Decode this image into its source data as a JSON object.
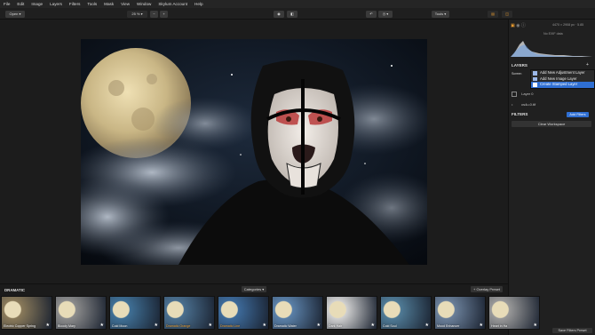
{
  "menubar": {
    "items": [
      "File",
      "Edit",
      "Image",
      "Layers",
      "Filters",
      "Tools",
      "Mask",
      "View",
      "Window",
      "Skylum Account",
      "Help"
    ]
  },
  "toolbar": {
    "open_label": "Open",
    "zoom_value": "25 %",
    "zoom_minus": "−",
    "zoom_plus": "+",
    "tools_label": "Tools"
  },
  "right_panel": {
    "image_info": "4470 × 2908 px · 5.85",
    "no_exif": "No EXIF data",
    "layers_title": "LAYERS",
    "blend_mode": "Screen",
    "layer_names": [
      "Layer 0",
      "cs4u.0.tif"
    ],
    "context_menu": [
      "Add New Adjustment Layer",
      "Add New Image Layer",
      "Create Stamped Layer"
    ],
    "filters_title": "FILTERS",
    "add_filters_label": "Add Filters",
    "clear_workspace_label": "Clear Workspace",
    "save_preset_label": "Save Filters Preset"
  },
  "presets": {
    "category_title": "DRAMATIC",
    "categories_label": "Categories",
    "overlay_label": "+ Overlay Preset",
    "thumbnails": [
      "Electric Copper Spring",
      "Bloody Mary",
      "Cold Moon",
      "Dramatic Orange",
      "Dramatic Line",
      "Dramatic Water",
      "Dark Hair",
      "Cold Soul",
      "Mood Enhancer",
      "Heart in Ha"
    ]
  },
  "colors": {
    "accent": "#2f6fd3",
    "highlight_text": "#f0a030"
  }
}
